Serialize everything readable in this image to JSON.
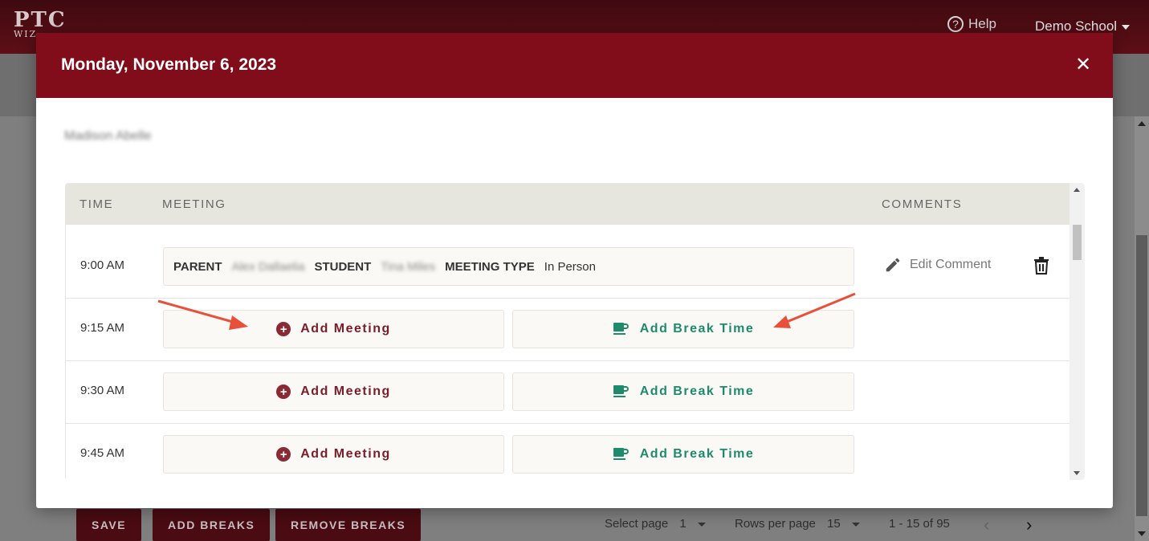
{
  "app": {
    "logo_main": "PTC",
    "logo_sub": "WIZ",
    "help_label": "Help",
    "school_name": "Demo School"
  },
  "footer": {
    "save_label": "SAVE",
    "add_breaks_label": "ADD BREAKS",
    "remove_breaks_label": "REMOVE BREAKS",
    "select_page_label": "Select page",
    "select_page_value": "1",
    "rows_per_page_label": "Rows per page",
    "rows_per_page_value": "15",
    "range_label": "1 - 15 of 95"
  },
  "modal": {
    "title": "Monday, November 6, 2023",
    "teacher_name": "Madison Abelle",
    "columns": {
      "time": "TIME",
      "meeting": "MEETING",
      "comments": "COMMENTS"
    },
    "rows": [
      {
        "time": "9:00 AM",
        "parent_label": "PARENT",
        "parent_value": "Alex Dallaelia",
        "student_label": "STUDENT",
        "student_value": "Tina Miles",
        "type_label": "MEETING TYPE",
        "type_value": "In Person",
        "edit_comment_label": "Edit Comment"
      },
      {
        "time": "9:15 AM",
        "add_meeting_label": "Add Meeting",
        "add_break_label": "Add Break Time"
      },
      {
        "time": "9:30 AM",
        "add_meeting_label": "Add Meeting",
        "add_break_label": "Add Break Time"
      },
      {
        "time": "9:45 AM",
        "add_meeting_label": "Add Meeting",
        "add_break_label": "Add Break Time"
      }
    ]
  },
  "colors": {
    "brand": "#820d1a",
    "break_green": "#1f8a6c",
    "meeting_red": "#7a1d2b",
    "annotation_arrow": "#e8503a"
  },
  "icons": [
    "help-icon",
    "close-icon",
    "plus-circle-icon",
    "coffee-cup-icon",
    "pencil-icon",
    "trash-icon",
    "chevron-left-icon",
    "chevron-right-icon"
  ]
}
